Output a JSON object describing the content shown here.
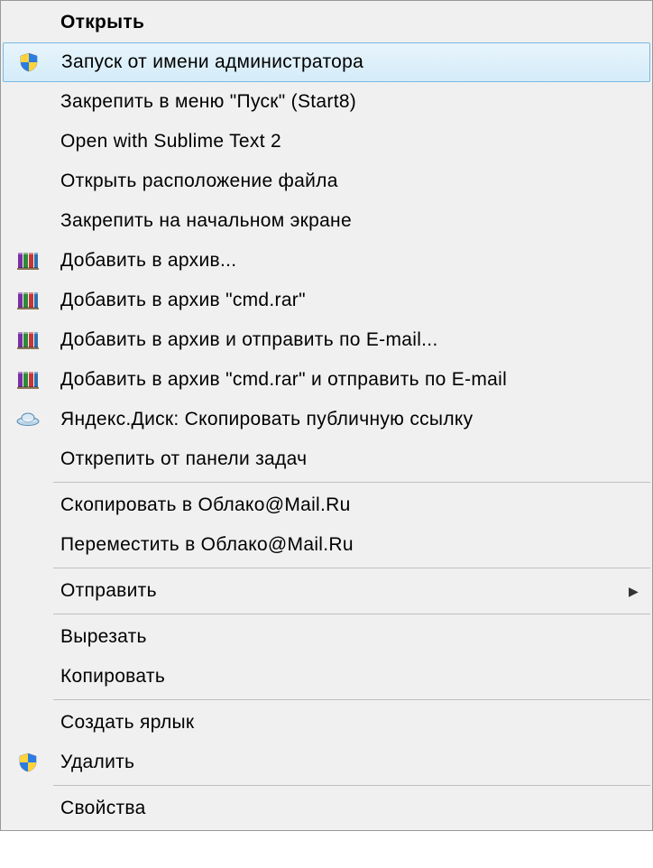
{
  "menu": {
    "items": [
      {
        "label": "Открыть",
        "icon": null,
        "bold": true,
        "highlighted": false,
        "submenu": false
      },
      {
        "label": "Запуск от имени администратора",
        "icon": "shield-uac-icon",
        "bold": false,
        "highlighted": true,
        "submenu": false
      },
      {
        "label": "Закрепить в меню \"Пуск\" (Start8)",
        "icon": null,
        "bold": false,
        "highlighted": false,
        "submenu": false
      },
      {
        "label": "Open with Sublime Text 2",
        "icon": null,
        "bold": false,
        "highlighted": false,
        "submenu": false
      },
      {
        "label": "Открыть расположение файла",
        "icon": null,
        "bold": false,
        "highlighted": false,
        "submenu": false
      },
      {
        "label": "Закрепить на начальном экране",
        "icon": null,
        "bold": false,
        "highlighted": false,
        "submenu": false
      },
      {
        "label": "Добавить в архив...",
        "icon": "winrar-icon",
        "bold": false,
        "highlighted": false,
        "submenu": false
      },
      {
        "label": "Добавить в архив \"cmd.rar\"",
        "icon": "winrar-icon",
        "bold": false,
        "highlighted": false,
        "submenu": false
      },
      {
        "label": "Добавить в архив и отправить по E-mail...",
        "icon": "winrar-icon",
        "bold": false,
        "highlighted": false,
        "submenu": false
      },
      {
        "label": "Добавить в архив \"cmd.rar\" и отправить по E-mail",
        "icon": "winrar-icon",
        "bold": false,
        "highlighted": false,
        "submenu": false
      },
      {
        "label": "Яндекс.Диск: Скопировать публичную ссылку",
        "icon": "yadisk-icon",
        "bold": false,
        "highlighted": false,
        "submenu": false
      },
      {
        "label": "Открепить от панели задач",
        "icon": null,
        "bold": false,
        "highlighted": false,
        "submenu": false
      },
      {
        "separator": true
      },
      {
        "label": "Скопировать в Облако@Mail.Ru",
        "icon": null,
        "bold": false,
        "highlighted": false,
        "submenu": false
      },
      {
        "label": "Переместить в Облако@Mail.Ru",
        "icon": null,
        "bold": false,
        "highlighted": false,
        "submenu": false
      },
      {
        "separator": true
      },
      {
        "label": "Отправить",
        "icon": null,
        "bold": false,
        "highlighted": false,
        "submenu": true
      },
      {
        "separator": true
      },
      {
        "label": "Вырезать",
        "icon": null,
        "bold": false,
        "highlighted": false,
        "submenu": false
      },
      {
        "label": "Копировать",
        "icon": null,
        "bold": false,
        "highlighted": false,
        "submenu": false
      },
      {
        "separator": true
      },
      {
        "label": "Создать ярлык",
        "icon": null,
        "bold": false,
        "highlighted": false,
        "submenu": false
      },
      {
        "label": "Удалить",
        "icon": "shield-uac-icon",
        "bold": false,
        "highlighted": false,
        "submenu": false
      },
      {
        "separator": true
      },
      {
        "label": "Свойства",
        "icon": null,
        "bold": false,
        "highlighted": false,
        "submenu": false
      }
    ]
  },
  "icons": {
    "shield-uac-icon": "shield",
    "winrar-icon": "books",
    "yadisk-icon": "ufo"
  }
}
